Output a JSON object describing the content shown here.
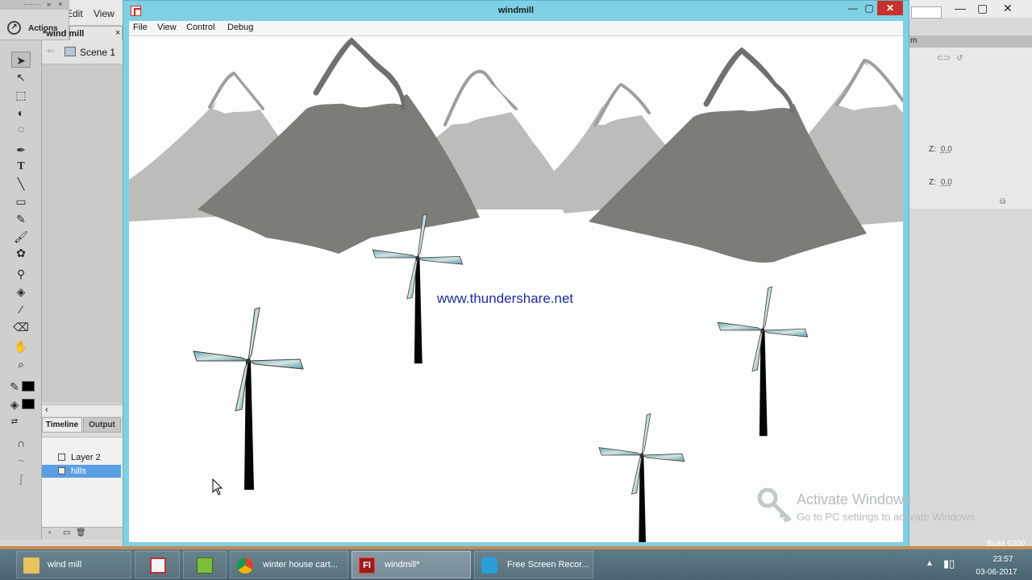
{
  "ide": {
    "menu": [
      "Edit",
      "View"
    ],
    "actions_label": "Actions",
    "document_tab": "wind mill*",
    "document_tab_close": "×",
    "scene_label": "Scene 1",
    "timeline_tab": "Timeline",
    "output_tab": "Output",
    "layers": [
      "Layer 2",
      "hills"
    ],
    "z_label_1": "Z:",
    "z_value_1": "0.0",
    "z_label_2": "Z:",
    "z_value_2": "0.0"
  },
  "player": {
    "title": "windmill",
    "menu": [
      "File",
      "View",
      "Control",
      "Debug"
    ],
    "stage_text": "www.thundershare.net",
    "colors": {
      "far_mountain": "#bcbdbb",
      "near_mountain": "#7b7d79",
      "blade": "#8fc2c4",
      "pole": "#050505"
    }
  },
  "watermark": {
    "title": "Activate Windows",
    "subtitle": "Go to PC settings to activate Windows."
  },
  "taskbar": {
    "items": [
      {
        "label": "wind mill",
        "icon": "folder-icon"
      },
      {
        "label": "",
        "icon": "paint-icon"
      },
      {
        "label": "",
        "icon": "notepad-icon"
      },
      {
        "label": "winter house cart...",
        "icon": "chrome-icon"
      },
      {
        "label": "windmill*",
        "icon": "flash-icon"
      },
      {
        "label": "Free Screen Recor...",
        "icon": "recorder-icon"
      }
    ],
    "build": "Build 9200",
    "time": "23:57",
    "date": "03-06-2017"
  }
}
